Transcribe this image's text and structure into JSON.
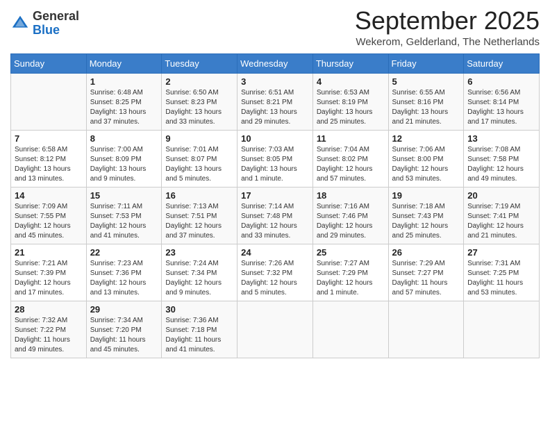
{
  "header": {
    "logo_general": "General",
    "logo_blue": "Blue",
    "month_title": "September 2025",
    "location": "Wekerom, Gelderland, The Netherlands"
  },
  "weekdays": [
    "Sunday",
    "Monday",
    "Tuesday",
    "Wednesday",
    "Thursday",
    "Friday",
    "Saturday"
  ],
  "weeks": [
    [
      {
        "day": "",
        "info": ""
      },
      {
        "day": "1",
        "info": "Sunrise: 6:48 AM\nSunset: 8:25 PM\nDaylight: 13 hours\nand 37 minutes."
      },
      {
        "day": "2",
        "info": "Sunrise: 6:50 AM\nSunset: 8:23 PM\nDaylight: 13 hours\nand 33 minutes."
      },
      {
        "day": "3",
        "info": "Sunrise: 6:51 AM\nSunset: 8:21 PM\nDaylight: 13 hours\nand 29 minutes."
      },
      {
        "day": "4",
        "info": "Sunrise: 6:53 AM\nSunset: 8:19 PM\nDaylight: 13 hours\nand 25 minutes."
      },
      {
        "day": "5",
        "info": "Sunrise: 6:55 AM\nSunset: 8:16 PM\nDaylight: 13 hours\nand 21 minutes."
      },
      {
        "day": "6",
        "info": "Sunrise: 6:56 AM\nSunset: 8:14 PM\nDaylight: 13 hours\nand 17 minutes."
      }
    ],
    [
      {
        "day": "7",
        "info": "Sunrise: 6:58 AM\nSunset: 8:12 PM\nDaylight: 13 hours\nand 13 minutes."
      },
      {
        "day": "8",
        "info": "Sunrise: 7:00 AM\nSunset: 8:09 PM\nDaylight: 13 hours\nand 9 minutes."
      },
      {
        "day": "9",
        "info": "Sunrise: 7:01 AM\nSunset: 8:07 PM\nDaylight: 13 hours\nand 5 minutes."
      },
      {
        "day": "10",
        "info": "Sunrise: 7:03 AM\nSunset: 8:05 PM\nDaylight: 13 hours\nand 1 minute."
      },
      {
        "day": "11",
        "info": "Sunrise: 7:04 AM\nSunset: 8:02 PM\nDaylight: 12 hours\nand 57 minutes."
      },
      {
        "day": "12",
        "info": "Sunrise: 7:06 AM\nSunset: 8:00 PM\nDaylight: 12 hours\nand 53 minutes."
      },
      {
        "day": "13",
        "info": "Sunrise: 7:08 AM\nSunset: 7:58 PM\nDaylight: 12 hours\nand 49 minutes."
      }
    ],
    [
      {
        "day": "14",
        "info": "Sunrise: 7:09 AM\nSunset: 7:55 PM\nDaylight: 12 hours\nand 45 minutes."
      },
      {
        "day": "15",
        "info": "Sunrise: 7:11 AM\nSunset: 7:53 PM\nDaylight: 12 hours\nand 41 minutes."
      },
      {
        "day": "16",
        "info": "Sunrise: 7:13 AM\nSunset: 7:51 PM\nDaylight: 12 hours\nand 37 minutes."
      },
      {
        "day": "17",
        "info": "Sunrise: 7:14 AM\nSunset: 7:48 PM\nDaylight: 12 hours\nand 33 minutes."
      },
      {
        "day": "18",
        "info": "Sunrise: 7:16 AM\nSunset: 7:46 PM\nDaylight: 12 hours\nand 29 minutes."
      },
      {
        "day": "19",
        "info": "Sunrise: 7:18 AM\nSunset: 7:43 PM\nDaylight: 12 hours\nand 25 minutes."
      },
      {
        "day": "20",
        "info": "Sunrise: 7:19 AM\nSunset: 7:41 PM\nDaylight: 12 hours\nand 21 minutes."
      }
    ],
    [
      {
        "day": "21",
        "info": "Sunrise: 7:21 AM\nSunset: 7:39 PM\nDaylight: 12 hours\nand 17 minutes."
      },
      {
        "day": "22",
        "info": "Sunrise: 7:23 AM\nSunset: 7:36 PM\nDaylight: 12 hours\nand 13 minutes."
      },
      {
        "day": "23",
        "info": "Sunrise: 7:24 AM\nSunset: 7:34 PM\nDaylight: 12 hours\nand 9 minutes."
      },
      {
        "day": "24",
        "info": "Sunrise: 7:26 AM\nSunset: 7:32 PM\nDaylight: 12 hours\nand 5 minutes."
      },
      {
        "day": "25",
        "info": "Sunrise: 7:27 AM\nSunset: 7:29 PM\nDaylight: 12 hours\nand 1 minute."
      },
      {
        "day": "26",
        "info": "Sunrise: 7:29 AM\nSunset: 7:27 PM\nDaylight: 11 hours\nand 57 minutes."
      },
      {
        "day": "27",
        "info": "Sunrise: 7:31 AM\nSunset: 7:25 PM\nDaylight: 11 hours\nand 53 minutes."
      }
    ],
    [
      {
        "day": "28",
        "info": "Sunrise: 7:32 AM\nSunset: 7:22 PM\nDaylight: 11 hours\nand 49 minutes."
      },
      {
        "day": "29",
        "info": "Sunrise: 7:34 AM\nSunset: 7:20 PM\nDaylight: 11 hours\nand 45 minutes."
      },
      {
        "day": "30",
        "info": "Sunrise: 7:36 AM\nSunset: 7:18 PM\nDaylight: 11 hours\nand 41 minutes."
      },
      {
        "day": "",
        "info": ""
      },
      {
        "day": "",
        "info": ""
      },
      {
        "day": "",
        "info": ""
      },
      {
        "day": "",
        "info": ""
      }
    ]
  ]
}
